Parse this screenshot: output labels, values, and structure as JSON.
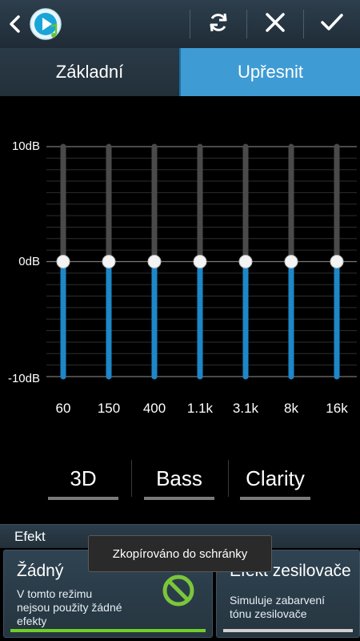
{
  "colors": {
    "accent": "#3f9bd4",
    "slider_fill": "#1d87c8",
    "slider_track": "#4a4a4a",
    "selected_bar": "#6fcf2a",
    "inactive_bar": "#cfcfcf"
  },
  "header": {
    "back_icon": "chevron-left-icon",
    "app_icon": "music-player-icon",
    "actions": [
      {
        "name": "reset-button",
        "icon": "refresh-icon"
      },
      {
        "name": "cancel-button",
        "icon": "close-icon"
      },
      {
        "name": "confirm-button",
        "icon": "check-icon"
      }
    ]
  },
  "tabs": [
    {
      "label": "Základní",
      "active": false
    },
    {
      "label": "Upřesnit",
      "active": true
    }
  ],
  "equalizer": {
    "db_labels": {
      "top": "10dB",
      "mid": "0dB",
      "bottom": "-10dB"
    },
    "range_db": [
      -10,
      10
    ],
    "bands": [
      {
        "freq": "60",
        "gain_db": 0
      },
      {
        "freq": "150",
        "gain_db": 0
      },
      {
        "freq": "400",
        "gain_db": 0
      },
      {
        "freq": "1.1k",
        "gain_db": 0
      },
      {
        "freq": "3.1k",
        "gain_db": 0
      },
      {
        "freq": "8k",
        "gain_db": 0
      },
      {
        "freq": "16k",
        "gain_db": 0
      }
    ]
  },
  "effects_buttons": {
    "b3d": "3D",
    "bass": "Bass",
    "clarity": "Clarity"
  },
  "effect_section": {
    "title": "Efekt",
    "cards": [
      {
        "title": "Žádný",
        "description_line1": "V tomto režimu",
        "description_line2": "nejsou použity žádné",
        "description_line3": "efekty",
        "selected": true,
        "icon": "no-effect-icon"
      },
      {
        "title": "Efekt zesilovače",
        "description_line1": "Simuluje zabarvení",
        "description_line2": "tónu zesilovače",
        "selected": false
      }
    ]
  },
  "toast": {
    "text": "Zkopírováno do schránky"
  }
}
